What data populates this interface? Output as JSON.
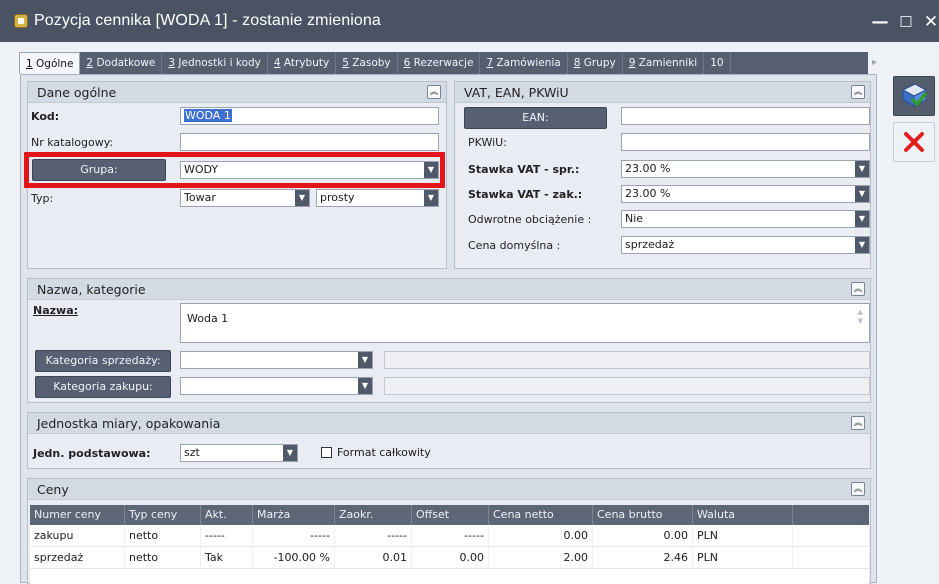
{
  "window": {
    "title": "Pozycja cennika [WODA 1] - zostanie zmieniona",
    "controls": {
      "minimize": "—",
      "maximize": "□",
      "close": "✕"
    }
  },
  "tabs": [
    {
      "key": "1",
      "rest": " Ogólne"
    },
    {
      "key": "2",
      "rest": " Dodatkowe"
    },
    {
      "key": "3",
      "rest": " Jednostki i kody"
    },
    {
      "key": "4",
      "rest": " Atrybuty"
    },
    {
      "key": "5",
      "rest": " Zasoby"
    },
    {
      "key": "6",
      "rest": " Rezerwacje"
    },
    {
      "key": "7",
      "rest": " Zamówienia"
    },
    {
      "key": "8",
      "rest": " Grupy"
    },
    {
      "key": "9",
      "rest": " Zamienniki"
    },
    {
      "key": "10",
      "rest": " "
    }
  ],
  "dane_ogolne": {
    "header": "Dane ogólne",
    "kod_label": "Kod:",
    "kod_value": "WODA 1",
    "nr_katalogowy_label": "Nr katalogowy:",
    "nr_katalogowy_value": "",
    "grupa_button": "Grupa:",
    "grupa_value": "WODY",
    "typ_label": "Typ:",
    "typ_value": "Towar",
    "typ2_value": "prosty"
  },
  "vat": {
    "header": "VAT, EAN, PKWiU",
    "ean_button": "EAN:",
    "ean_value": "",
    "pkwiu_label": "PKWiU:",
    "pkwiu_value": "",
    "stawka_spr_label": "Stawka VAT - spr.:",
    "stawka_spr_value": "23.00 %",
    "stawka_zak_label": "Stawka VAT - zak.:",
    "stawka_zak_value": "23.00 %",
    "odwrotne_label": "Odwrotne obciążenie :",
    "odwrotne_value": "Nie",
    "cena_domyslna_label": "Cena domyślna :",
    "cena_domyslna_value": "sprzedaż"
  },
  "nazwa": {
    "header": "Nazwa, kategorie",
    "nazwa_label": "Nazwa:",
    "nazwa_value": "Woda 1",
    "kat_sprzedazy_button": "Kategoria sprzedaży:",
    "kat_sprzedazy_value": "",
    "kat_zakupu_button": "Kategoria zakupu:",
    "kat_zakupu_value": ""
  },
  "jednostka": {
    "header": "Jednostka miary, opakowania",
    "jedn_label": "Jedn. podstawowa:",
    "jedn_value": "szt",
    "format_label": "Format całkowity"
  },
  "ceny": {
    "header": "Ceny",
    "columns": [
      "Numer ceny",
      "Typ ceny",
      "Akt.",
      "Marża",
      "Zaokr.",
      "Offset",
      "Cena netto",
      "Cena brutto",
      "Waluta"
    ],
    "rows": [
      [
        "zakupu",
        "netto",
        "-----",
        "-----",
        "-----",
        "-----",
        "0.00",
        "0.00",
        "PLN"
      ],
      [
        "sprzedaż",
        "netto",
        "Tak",
        "-100.00 %",
        "0.01",
        "0.00",
        "2.00",
        "2.46",
        "PLN"
      ]
    ]
  },
  "colors": {
    "highlight": "#e4141b",
    "titlebar": "#4a5364",
    "button": "#566072"
  },
  "icons": {
    "save": "save-floppy-check-icon",
    "cancel": "cancel-x-icon"
  }
}
